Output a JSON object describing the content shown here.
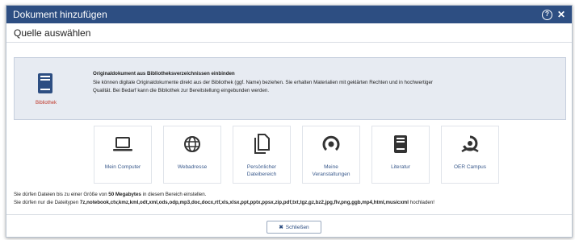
{
  "window": {
    "title": "Dokument hinzufügen"
  },
  "header": {
    "section_title": "Quelle auswählen"
  },
  "info": {
    "source_label": "Bibliothek",
    "heading": "Originaldokument aus Bibliotheksverzeichnissen einbinden",
    "line1": "Sie können digitale Originaldokumente direkt aus der Bibliothek (ggf. Name) beziehen. Sie erhalten Materialien mit geklärten Rechten und in hochwertiger",
    "line2": "Qualität. Bei Bedarf kann die Bibliothek zur Bereitstellung eingebunden werden."
  },
  "sources": [
    {
      "label": "Mein Computer",
      "icon": "laptop-icon"
    },
    {
      "label": "Webadresse",
      "icon": "globe-icon"
    },
    {
      "label_line1": "Persönlicher",
      "label_line2": "Dateibereich",
      "icon": "documents-icon"
    },
    {
      "label_line1": "Meine",
      "label_line2": "Veranstaltungen",
      "icon": "events-icon"
    },
    {
      "label": "Literatur",
      "icon": "book-icon"
    },
    {
      "label": "OER Campus",
      "icon": "oer-icon"
    }
  ],
  "limits": {
    "size_prefix": "Sie dürfen Dateien bis zu einer Größe von ",
    "size_value": "50 Megabytes",
    "size_suffix": " in diesem Bereich einstellen.",
    "types_prefix": "Sie dürfen nur die Dateitypen ",
    "types_list": "7z,notebook,ctv,kmz,kml,odt,xml,ods,odp,mp3,doc,docx,rtf,xls,xlsx,ppt,pptx,ppsx,zip,pdf,txt,tgz,gz,bz2,jpg,flv,png,ggb,mp4,html,musicxml",
    "types_suffix": " hochladen!"
  },
  "footer": {
    "close_label": "Schließen"
  },
  "colors": {
    "titlebar": "#2d4e82",
    "accent": "#3a5a8c",
    "library_red": "#c0392b",
    "info_bg": "#e7ebf2"
  }
}
